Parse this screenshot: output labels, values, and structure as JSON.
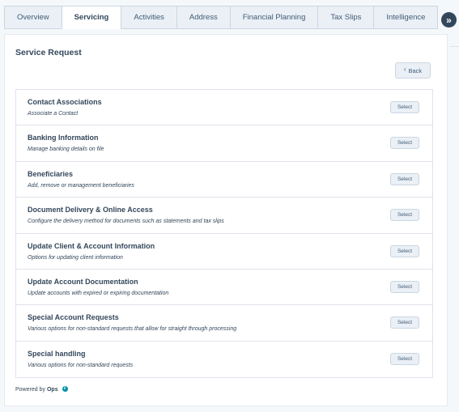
{
  "tabs": [
    {
      "label": "Overview",
      "active": false
    },
    {
      "label": "Servicing",
      "active": true
    },
    {
      "label": "Activities",
      "active": false
    },
    {
      "label": "Address",
      "active": false
    },
    {
      "label": "Financial Planning",
      "active": false
    },
    {
      "label": "Tax Slips",
      "active": false
    },
    {
      "label": "Intelligence",
      "active": false
    }
  ],
  "collapse_icon": "»",
  "card": {
    "title": "Service Request",
    "back_label": "Back",
    "back_icon": "‹"
  },
  "requests": [
    {
      "title": "Contact Associations",
      "description": "Associate a Contact",
      "button": "Select"
    },
    {
      "title": "Banking Information",
      "description": "Manage banking details on file",
      "button": "Select"
    },
    {
      "title": "Beneficiaries",
      "description": "Add, remove or management beneficiaries",
      "button": "Select"
    },
    {
      "title": "Document Delivery & Online Access",
      "description": "Configure the delivery method for documents such as statements and tax slips",
      "button": "Select"
    },
    {
      "title": "Update Client & Account Information",
      "description": "Options for updating client information",
      "button": "Select"
    },
    {
      "title": "Update Account Documentation",
      "description": "Update accounts with expired or expiring documentation",
      "button": "Select"
    },
    {
      "title": "Special Account Requests",
      "description": "Various options for non-standard requests that allow for straight through processing",
      "button": "Select"
    },
    {
      "title": "Special handling",
      "description": "Various options for non-standard requests",
      "button": "Select"
    }
  ],
  "footer": {
    "powered_prefix": "Powered by",
    "powered_brand": "Ops",
    "info_icon": "i"
  },
  "colors": {
    "text": "#33475b",
    "accent_dark": "#33475b",
    "info": "#0091ae",
    "button_bg": "#eaf0f6",
    "border": "#cbd6e2"
  }
}
